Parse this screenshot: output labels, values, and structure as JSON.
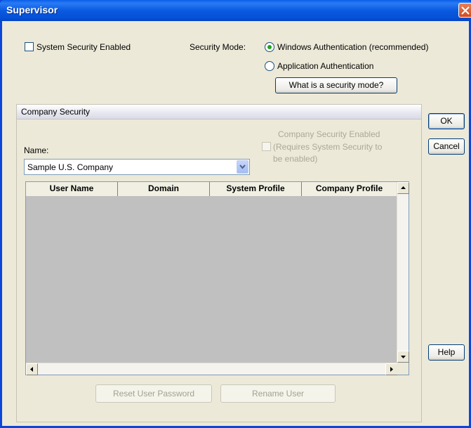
{
  "window": {
    "title": "Supervisor"
  },
  "system_security": {
    "checkbox_label": "System Security Enabled",
    "checked": false
  },
  "security_mode": {
    "label": "Security Mode:",
    "options": [
      {
        "label": "Windows Authentication (recommended)",
        "selected": true
      },
      {
        "label": "Application Authentication",
        "selected": false
      }
    ],
    "help_button": "What is a security mode?"
  },
  "company_security": {
    "group_title": "Company Security",
    "name_label": "Name:",
    "name_value": "Sample U.S. Company",
    "enabled_label_line1": "Company Security Enabled",
    "enabled_label_line2": "(Requires System Security to",
    "enabled_label_line3": "be enabled)",
    "enabled_checked": false
  },
  "users_table": {
    "columns": [
      "User Name",
      "Domain",
      "System Profile",
      "Company Profile"
    ],
    "rows": []
  },
  "actions": {
    "reset_password": "Reset User Password",
    "rename_user": "Rename User"
  },
  "dialog_buttons": {
    "ok": "OK",
    "cancel": "Cancel",
    "help": "Help"
  },
  "colors": {
    "titlebar": "#0a5ae0",
    "dialog_bg": "#ece9d8",
    "grid_bg": "#c0c0c0",
    "radio_dot": "#21a121"
  }
}
